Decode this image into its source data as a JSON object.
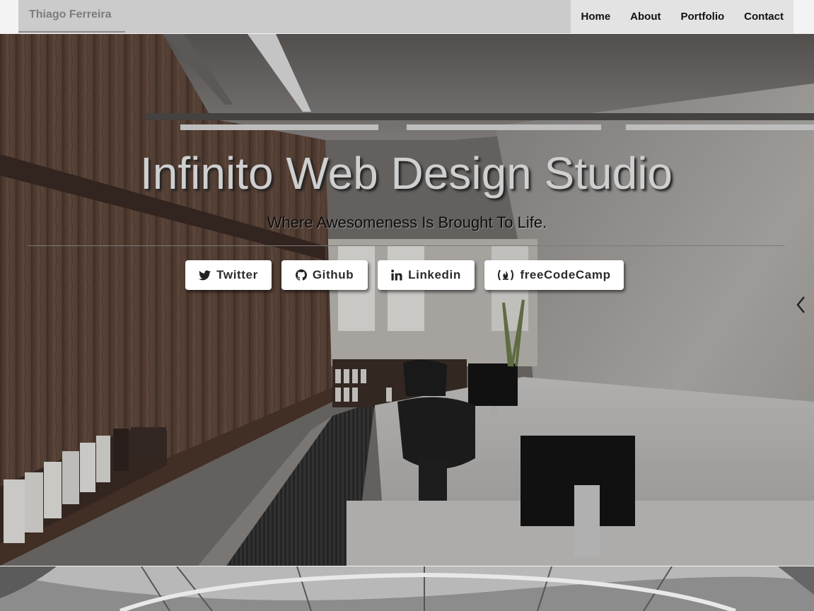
{
  "navbar": {
    "brand": "Thiago Ferreira",
    "links": [
      "Home",
      "About",
      "Portfolio",
      "Contact"
    ]
  },
  "hero": {
    "title": "Infinito Web Design Studio",
    "subtitle": "Where Awesomeness Is Brought To Life.",
    "buttons": [
      {
        "label": "Twitter",
        "icon": "twitter-icon"
      },
      {
        "label": "Github",
        "icon": "github-icon"
      },
      {
        "label": "Linkedin",
        "icon": "linkedin-icon"
      },
      {
        "label": "freeCodeCamp",
        "icon": "freecodecamp-icon"
      }
    ]
  },
  "colors": {
    "navbar_bg": "#cbcbcb",
    "nav_right_bg": "#e3e3e3",
    "title_text": "#cfcfcf",
    "button_bg": "#ffffff"
  }
}
